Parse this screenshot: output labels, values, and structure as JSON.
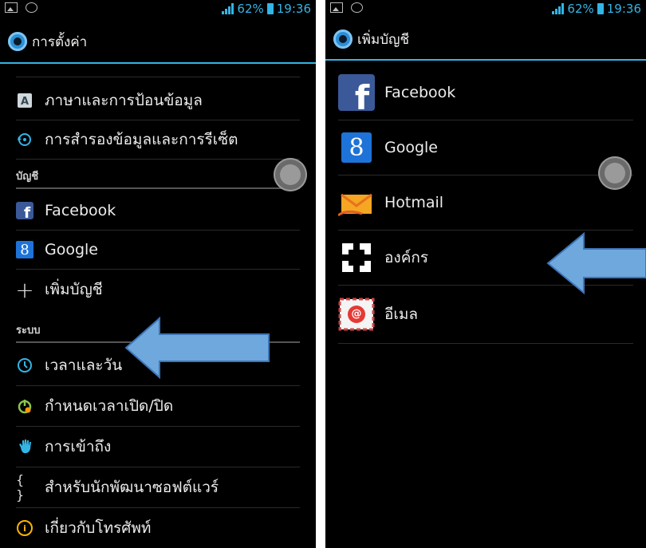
{
  "left": {
    "status": {
      "battery": "62%",
      "time": "19:36"
    },
    "title": "การตั้งค่า",
    "items_top": [
      {
        "label": "ภาษาและการป้อนข้อมูล",
        "icon": "keyboard-icon"
      },
      {
        "label": "การสำรองข้อมูลและการรีเซ็ต",
        "icon": "backup-reset-icon"
      }
    ],
    "section_accounts": "บัญชี",
    "items_accounts": [
      {
        "label": "Facebook",
        "icon": "facebook-icon"
      },
      {
        "label": "Google",
        "icon": "google-icon"
      },
      {
        "label": "เพิ่มบัญชี",
        "icon": "plus-icon"
      }
    ],
    "section_system": "ระบบ",
    "items_system": [
      {
        "label": "เวลาและวัน",
        "icon": "clock-icon"
      },
      {
        "label": "กำหนดเวลาเปิด/ปิด",
        "icon": "power-schedule-icon"
      },
      {
        "label": "การเข้าถึง",
        "icon": "hand-icon"
      },
      {
        "label": "สำหรับนักพัฒนาซอฟต์แวร์",
        "icon": "braces-icon"
      },
      {
        "label": "เกี่ยวกับโทรศัพท์",
        "icon": "info-icon"
      }
    ],
    "glyph_braces": "{ }",
    "glyph_plus": "+",
    "glyph_info": "i",
    "glyph_google": "8"
  },
  "right": {
    "status": {
      "battery": "62%",
      "time": "19:36"
    },
    "title": "เพิ่มบัญชี",
    "accounts": [
      {
        "label": "Facebook",
        "icon": "facebook-icon"
      },
      {
        "label": "Google",
        "icon": "google-icon"
      },
      {
        "label": "Hotmail",
        "icon": "hotmail-icon"
      },
      {
        "label": "องค์กร",
        "icon": "exchange-icon"
      },
      {
        "label": "อีเมล",
        "icon": "email-icon"
      }
    ],
    "glyph_google": "8",
    "glyph_email": "@"
  },
  "colors": {
    "accent": "#33b5e5",
    "arrow": "#6fa8dc",
    "background": "#000000"
  }
}
